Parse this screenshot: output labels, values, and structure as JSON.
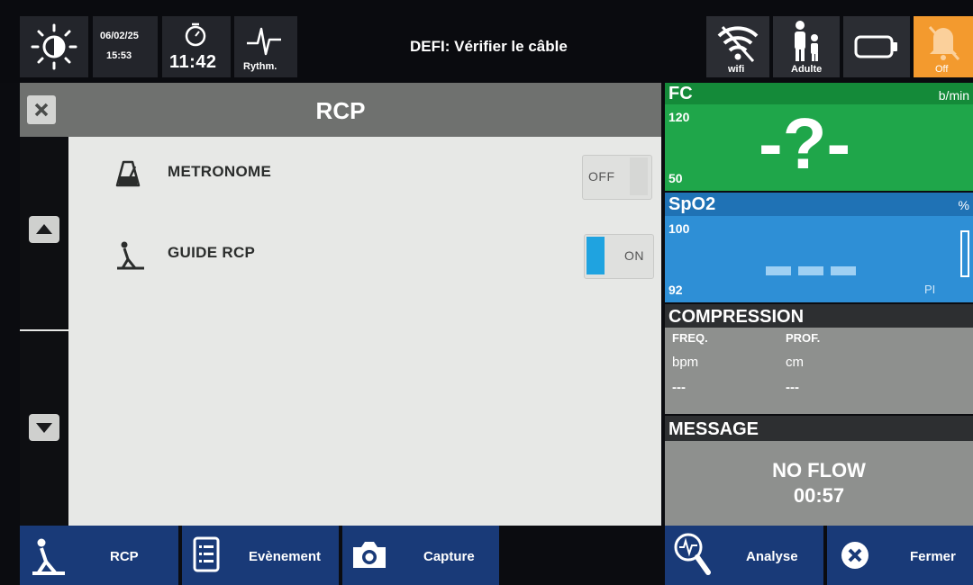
{
  "topbar": {
    "brightness_icon": "sun-half-icon",
    "date": "06/02/25",
    "time": "15:53",
    "elapsed_time": "11:42",
    "rhythm_label": "Rythm.",
    "alert_message": "DEFI: Vérifier le câble",
    "wifi_label": "wifi",
    "patient_label": "Adulte",
    "alarm_label": "Off"
  },
  "dialog": {
    "title": "RCP",
    "options": [
      {
        "label": "METRONOME",
        "icon": "metronome-icon",
        "state": "OFF",
        "enabled": false
      },
      {
        "label": "GUIDE RCP",
        "icon": "cpr-guide-icon",
        "state": "ON",
        "enabled": true
      }
    ]
  },
  "panels": {
    "fc": {
      "title": "FC",
      "unit": "b/min",
      "upper": "120",
      "lower": "50",
      "value": "-?-",
      "color": "#1fa64a"
    },
    "spo2": {
      "title": "SpO2",
      "unit": "%",
      "upper": "100",
      "lower": "92",
      "value": "---",
      "pi_label": "PI",
      "color": "#2e8fd6"
    },
    "compression": {
      "title": "COMPRESSION",
      "freq_label": "FREQ.",
      "prof_label": "PROF.",
      "freq_unit": "bpm",
      "prof_unit": "cm",
      "freq_value": "---",
      "prof_value": "---"
    },
    "message": {
      "title": "MESSAGE",
      "line1": "NO FLOW",
      "line2": "00:57"
    }
  },
  "bottombar": {
    "rcp": "RCP",
    "evenement": "Evènement",
    "capture": "Capture",
    "analyse": "Analyse",
    "fermer": "Fermer"
  },
  "colors": {
    "accent_blue": "#193a78",
    "toggle_on": "#1fa3e0",
    "alarm_orange": "#f39a2e"
  }
}
